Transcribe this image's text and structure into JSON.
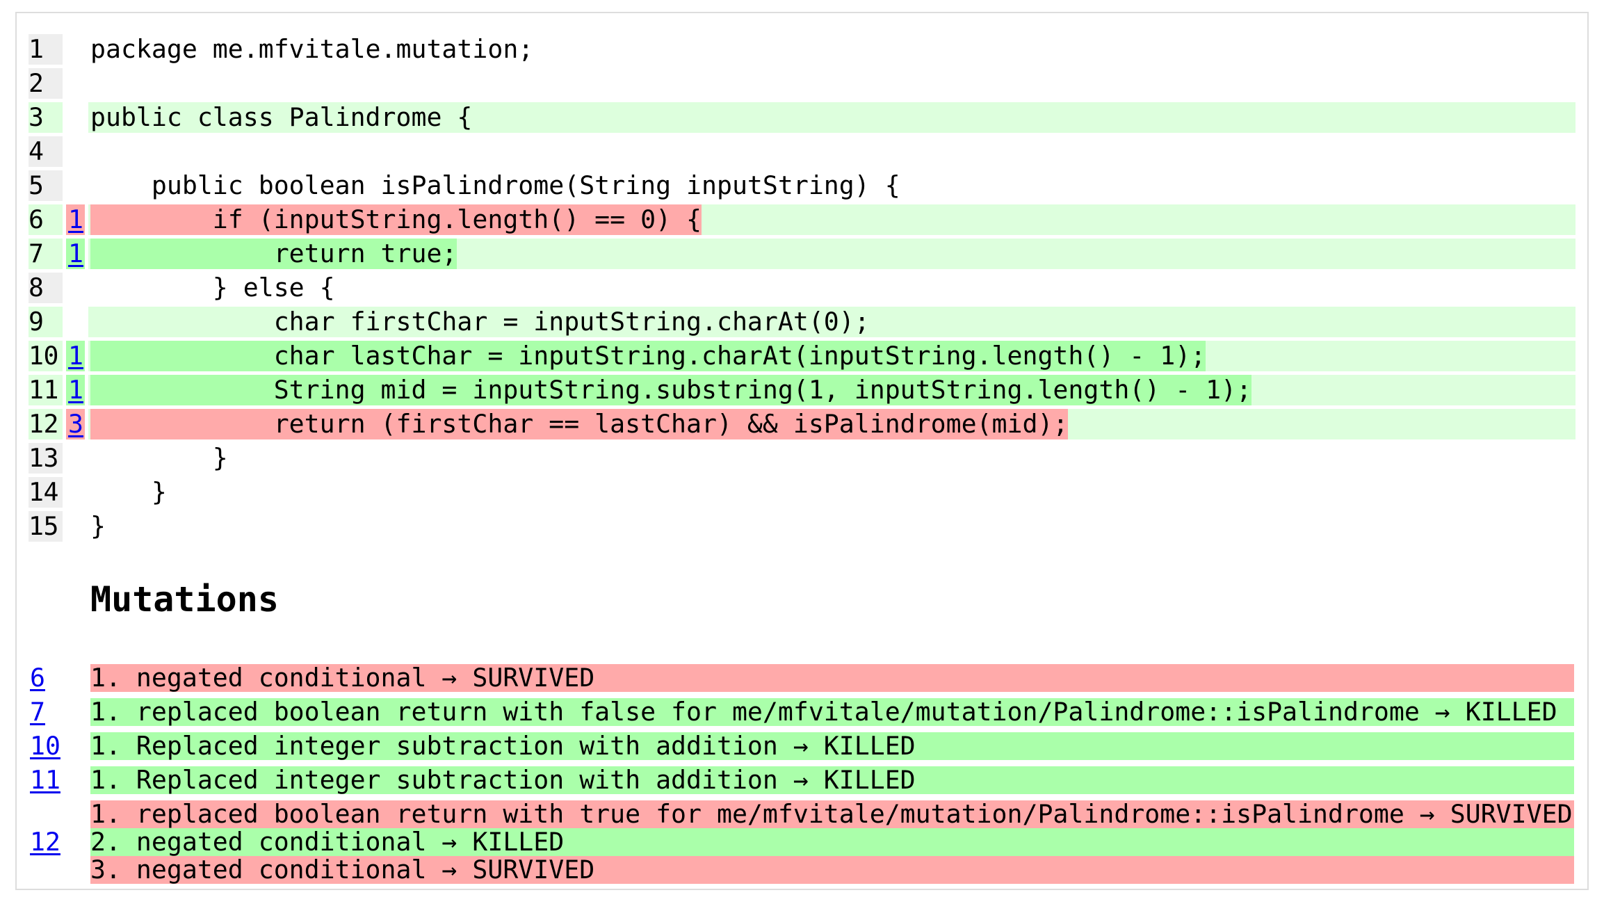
{
  "colors": {
    "covered_line": "#ddffdd",
    "uncovered_line": "#eeeeee",
    "survived": "#ffaaaa",
    "killed": "#aaffaa",
    "link": "#0000ee",
    "frame_border": "#dddddd"
  },
  "source": {
    "lines": [
      {
        "number": "1",
        "covered": false,
        "mutation_count": "",
        "mutation_status": "",
        "code": "package me.mfvitale.mutation;"
      },
      {
        "number": "2",
        "covered": false,
        "mutation_count": "",
        "mutation_status": "",
        "code": ""
      },
      {
        "number": "3",
        "covered": true,
        "mutation_count": "",
        "mutation_status": "",
        "code": "public class Palindrome {"
      },
      {
        "number": "4",
        "covered": false,
        "mutation_count": "",
        "mutation_status": "",
        "code": ""
      },
      {
        "number": "5",
        "covered": false,
        "mutation_count": "",
        "mutation_status": "",
        "code": "    public boolean isPalindrome(String inputString) {"
      },
      {
        "number": "6",
        "covered": true,
        "mutation_count": "1",
        "mutation_status": "survived",
        "code": "        if (inputString.length() == 0) {"
      },
      {
        "number": "7",
        "covered": true,
        "mutation_count": "1",
        "mutation_status": "killed",
        "code": "            return true;"
      },
      {
        "number": "8",
        "covered": false,
        "mutation_count": "",
        "mutation_status": "",
        "code": "        } else {"
      },
      {
        "number": "9",
        "covered": true,
        "mutation_count": "",
        "mutation_status": "",
        "code": "            char firstChar = inputString.charAt(0);"
      },
      {
        "number": "10",
        "covered": true,
        "mutation_count": "1",
        "mutation_status": "killed",
        "code": "            char lastChar = inputString.charAt(inputString.length() - 1);"
      },
      {
        "number": "11",
        "covered": true,
        "mutation_count": "1",
        "mutation_status": "killed",
        "code": "            String mid = inputString.substring(1, inputString.length() - 1);"
      },
      {
        "number": "12",
        "covered": true,
        "mutation_count": "3",
        "mutation_status": "survived",
        "code": "            return (firstChar == lastChar) && isPalindrome(mid);"
      },
      {
        "number": "13",
        "covered": false,
        "mutation_count": "",
        "mutation_status": "",
        "code": "        }"
      },
      {
        "number": "14",
        "covered": false,
        "mutation_count": "",
        "mutation_status": "",
        "code": "    }"
      },
      {
        "number": "15",
        "covered": false,
        "mutation_count": "",
        "mutation_status": "",
        "code": "}"
      }
    ]
  },
  "mutations": {
    "heading": "Mutations",
    "groups": [
      {
        "line": "6",
        "items": [
          {
            "text": "1. negated conditional → SURVIVED",
            "status": "survived"
          }
        ]
      },
      {
        "line": "7",
        "items": [
          {
            "text": "1. replaced boolean return with false for me/mfvitale/mutation/Palindrome::isPalindrome → KILLED",
            "status": "killed"
          }
        ]
      },
      {
        "line": "10",
        "items": [
          {
            "text": "1. Replaced integer subtraction with addition → KILLED",
            "status": "killed"
          }
        ]
      },
      {
        "line": "11",
        "items": [
          {
            "text": "1. Replaced integer subtraction with addition → KILLED",
            "status": "killed"
          }
        ]
      },
      {
        "line": "12",
        "items": [
          {
            "text": "1. replaced boolean return with true for me/mfvitale/mutation/Palindrome::isPalindrome → SURVIVED",
            "status": "survived"
          },
          {
            "text": "2. negated conditional → KILLED",
            "status": "killed"
          },
          {
            "text": "3. negated conditional → SURVIVED",
            "status": "survived"
          }
        ]
      }
    ]
  }
}
